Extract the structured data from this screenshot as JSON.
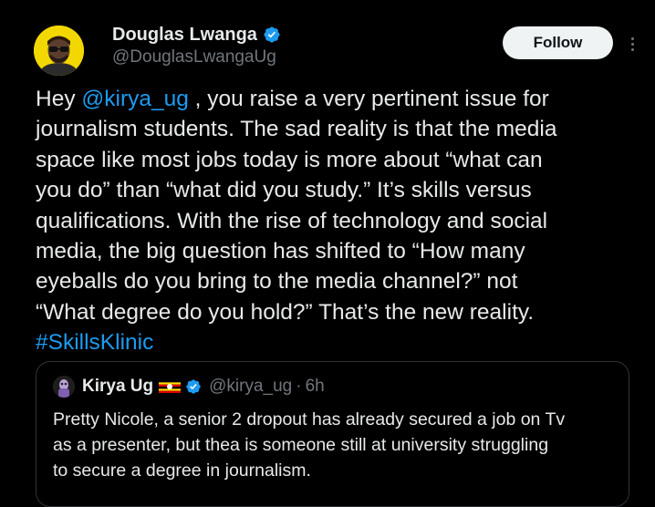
{
  "author": {
    "display_name": "Douglas Lwanga",
    "handle": "@DouglasLwangaUg",
    "verified_icon": "verified-badge-icon",
    "avatar_icon": "cartoon-avatar-icon"
  },
  "actions": {
    "follow_label": "Follow",
    "more_icon": "more-options-icon"
  },
  "tweet": {
    "lines": [
      {
        "pre": "Hey ",
        "mention": "@kirya_ug",
        "post": " , you raise a very pertinent issue for"
      },
      "journalism students. The sad reality is that the media",
      "space like most jobs today is more about “what can",
      "you do” than “what did you study.” It’s skills versus",
      "qualifications. With the rise of technology and social",
      "media, the big question has shifted to “How many",
      "eyeballs do you bring to the media channel?” not",
      "“What degree do you hold?” That’s the new reality.",
      {
        "hashtag": "#SkillsKlinic"
      }
    ]
  },
  "quoted_tweet": {
    "display_name": "Kirya Ug",
    "flag_icon": "uganda-flag-icon",
    "verified_icon": "verified-badge-icon",
    "handle": "@kirya_ug",
    "separator": "·",
    "time": "6h",
    "lines": [
      "Pretty Nicole, a senior 2 dropout has already secured a job on Tv",
      "as a presenter, but thea is someone still at university struggling",
      "to secure a degree in journalism."
    ]
  },
  "colors": {
    "background": "#000000",
    "text": "#e7e9ea",
    "muted": "#71767b",
    "link": "#1d9bf0",
    "verified": "#1d9bf0",
    "follow_bg": "#eff3f4",
    "border": "#2f3336"
  }
}
